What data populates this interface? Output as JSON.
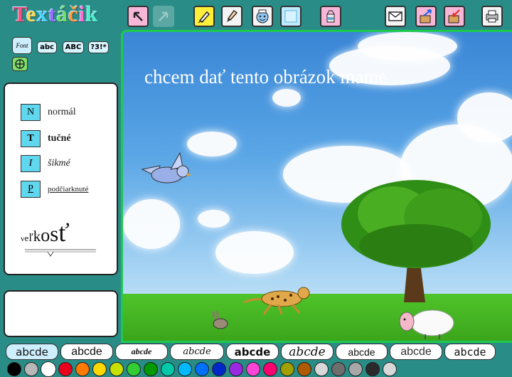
{
  "app": {
    "logo_text": "Textáčik",
    "logo_letters": [
      "T",
      "e",
      "x",
      "t",
      "á",
      "č",
      "i",
      "k"
    ],
    "logo_colors": [
      "#ff4f7a",
      "#ffd84a",
      "#4ad3ff",
      "#9b6bff",
      "#6ee06a",
      "#ff9a3c",
      "#ff6bd1",
      "#4af0c8"
    ]
  },
  "toolbar": {
    "buttons": [
      {
        "name": "undo-button",
        "icon": "arrow-back-icon",
        "glyph": "↖"
      },
      {
        "name": "redo-button",
        "icon": "arrow-forward-icon",
        "glyph": "↗"
      },
      {
        "name": "pen-tool-button",
        "icon": "pen-icon",
        "glyph": "✎"
      },
      {
        "name": "brush-tool-button",
        "icon": "brush-icon",
        "glyph": "✍"
      },
      {
        "name": "character-button",
        "icon": "face-icon",
        "glyph": "☺"
      },
      {
        "name": "blank-page-button",
        "icon": "page-icon",
        "glyph": ""
      },
      {
        "name": "paint-bucket-button",
        "icon": "bucket-icon",
        "glyph": "⛾"
      },
      {
        "name": "mail-button",
        "icon": "envelope-icon",
        "glyph": "✉"
      },
      {
        "name": "open-button",
        "icon": "box-arrow-in-icon",
        "glyph": "⇗"
      },
      {
        "name": "save-button",
        "icon": "box-arrow-out-icon",
        "glyph": "⇙"
      },
      {
        "name": "print-button",
        "icon": "printer-icon",
        "glyph": "⎙"
      }
    ]
  },
  "font_controls": {
    "font_button": "Font",
    "case_lower": "abc",
    "case_upper": "ABC",
    "symbols": "?3!*"
  },
  "styles": {
    "normal": {
      "key": "N",
      "label": "normál"
    },
    "bold": {
      "key": "T",
      "label": "tučné"
    },
    "italic": {
      "key": "I",
      "label": "šikmé"
    },
    "underline": {
      "key": "P",
      "label": "podčiarknuté"
    },
    "size_label": "veľkosť"
  },
  "canvas": {
    "text": "chcem dať tento obrázok mame"
  },
  "font_samples": [
    "abcde",
    "abcde",
    "abcde",
    "abcde",
    "abcde",
    "abcde",
    "abcde",
    "abcde",
    "abcde"
  ],
  "palette": [
    "#000000",
    "#b8b8b8",
    "#ffffff",
    "#e8001c",
    "#ff7a00",
    "#ffd800",
    "#c8e000",
    "#33cc33",
    "#009a00",
    "#00c8a8",
    "#00b8ff",
    "#0070ff",
    "#0028c8",
    "#9a28e0",
    "#ff44d8",
    "#ff0070",
    "#a0a000",
    "#b05a00",
    "#d8d8d8",
    "#6e6e6e",
    "#a8a8a8",
    "#2a2a2a",
    "#d8d8d8"
  ]
}
